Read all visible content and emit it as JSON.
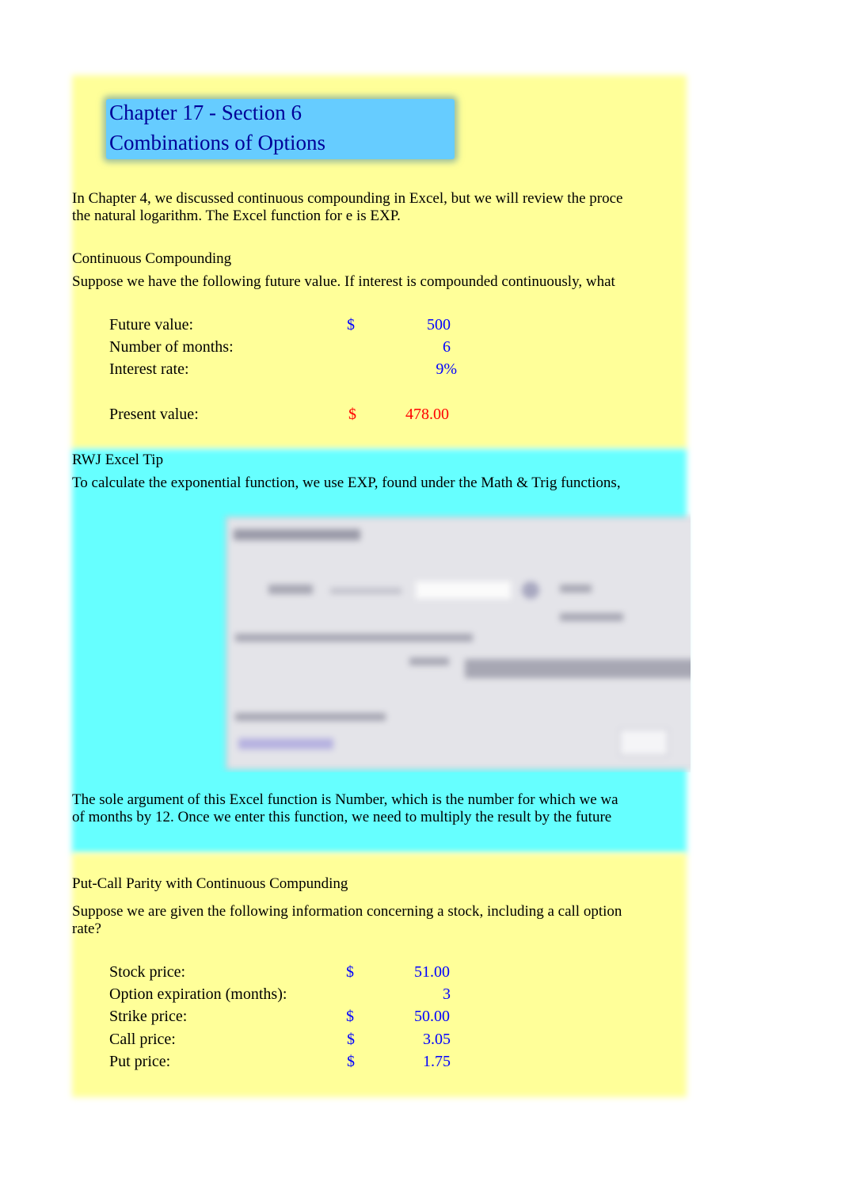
{
  "header": {
    "title_line1": "Chapter 17 - Section 6",
    "title_line2": "Combinations of Options"
  },
  "intro": {
    "line1": "In Chapter 4, we discussed continuous compounding in Excel, but we will review the proce",
    "line2": "the natural logarithm. The Excel function for e is EXP."
  },
  "continuous_compounding": {
    "heading": "Continuous Compounding",
    "prompt": "Suppose we have the following future value. If interest is compounded continuously, what",
    "rows": [
      {
        "label": "Future value:",
        "currency": "$",
        "value": "500"
      },
      {
        "label": "Number of months:",
        "currency": "",
        "value": "6"
      },
      {
        "label": "Interest rate:",
        "currency": "",
        "value": "9%"
      }
    ],
    "result": {
      "label": "Present value:",
      "currency": "$",
      "value": "478.00"
    }
  },
  "excel_tip": {
    "heading": "RWJ Excel Tip",
    "line1": "To calculate the exponential function, we use EXP, found under the Math & Trig functions,",
    "dialog_image": "function-arguments-dialog-screenshot",
    "after_line1": "The sole argument of this Excel function is Number, which is the number for which we wa",
    "after_line2": "of months by 12. Once we enter this function, we need to multiply the result by the future"
  },
  "put_call": {
    "heading": "Put-Call Parity with Continuous Compunding",
    "prompt_line1": "Suppose we are given the following information concerning a stock, including a call option",
    "prompt_line2": "rate?",
    "rows": [
      {
        "label": "Stock price:",
        "currency": "$",
        "value": "51.00"
      },
      {
        "label": "Option expiration (months):",
        "currency": "",
        "value": "3"
      },
      {
        "label": "Strike price:",
        "currency": "$",
        "value": "50.00"
      },
      {
        "label": "Call price:",
        "currency": "$",
        "value": "3.05"
      },
      {
        "label": "Put price:",
        "currency": "$",
        "value": "1.75"
      }
    ]
  },
  "colors": {
    "yellow_band": "#ffff99",
    "cyan_band": "#66ffff",
    "title_box": "#66ccff",
    "title_text": "#000099",
    "input_value": "#0000ff",
    "output_value": "#ff0000"
  }
}
